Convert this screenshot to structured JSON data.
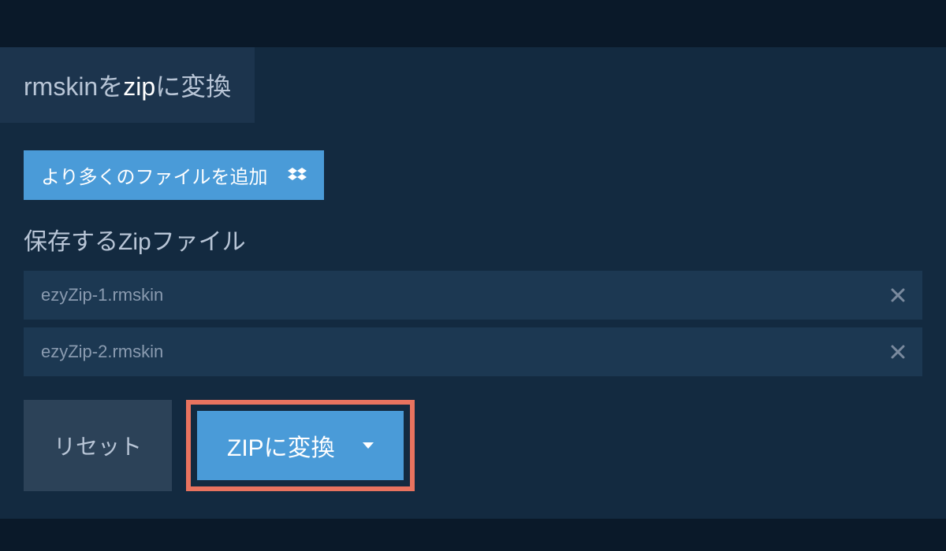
{
  "tab": {
    "prefix": "rmskin",
    "middle": "を",
    "highlight": "zip",
    "suffix": "に変換"
  },
  "buttons": {
    "add_files": "より多くのファイルを追加",
    "reset": "リセット",
    "convert": "ZIPに変換"
  },
  "section_title": "保存するZipファイル",
  "files": [
    "ezyZip-1.rmskin",
    "ezyZip-2.rmskin"
  ],
  "colors": {
    "accent": "#4a9bd8",
    "highlight_border": "#e8735f",
    "bg_dark": "#0a1929",
    "bg_panel": "#132a40",
    "bg_item": "#1c3852"
  }
}
